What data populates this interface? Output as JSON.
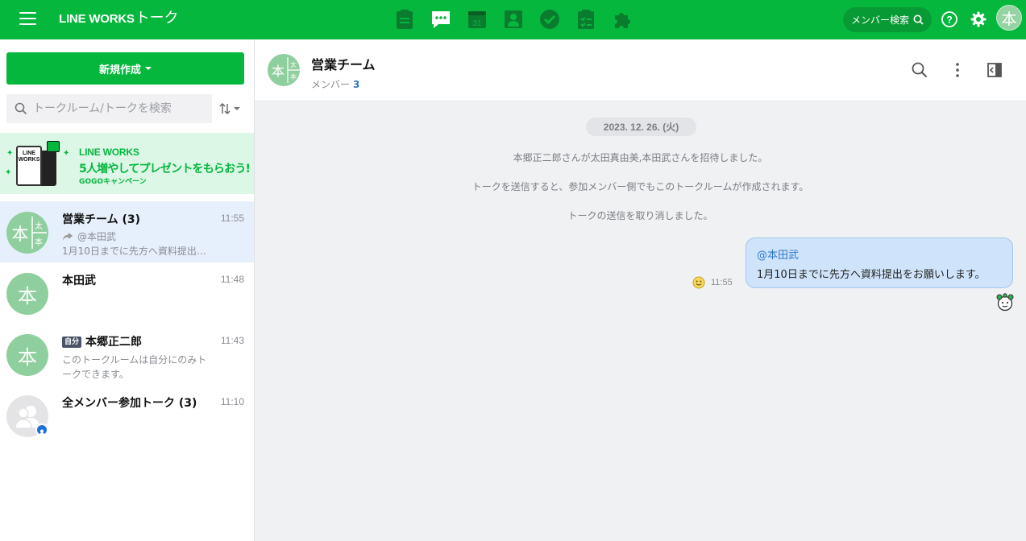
{
  "topbar": {
    "brand": "LINE WORKS",
    "brand_sub": "トーク",
    "member_search": "メンバー検索",
    "avatar_char": "本",
    "apps": [
      "board-icon",
      "talk-icon",
      "calendar-icon",
      "contacts-icon",
      "task-icon",
      "survey-icon",
      "extension-icon"
    ]
  },
  "sidebar": {
    "new_button": "新規作成",
    "search_placeholder": "トークルーム/トークを検索",
    "banner": {
      "line1": "LINE WORKS",
      "line2": "5人増やしてプレゼントをもらおう!",
      "line3": "GOGOキャンペーン",
      "phone_text": "LINE WORKS"
    },
    "rooms": [
      {
        "name": "営業チーム (3)",
        "time": "11:55",
        "line1": "@本田武",
        "line2": "1月10日までに先方へ資料提出…",
        "avatar": "本",
        "avatar_small_1": "太",
        "avatar_small_2": "本"
      },
      {
        "name": "本田武",
        "time": "11:48",
        "avatar": "本"
      },
      {
        "name": "本郷正二郎",
        "badge": "自分",
        "time": "11:43",
        "preview": "このトークルームは自分にのみトークできます。",
        "avatar": "本"
      },
      {
        "name": "全メンバー参加トーク (3)",
        "time": "11:10"
      }
    ]
  },
  "chat": {
    "title": "営業チーム",
    "members_label": "メンバー",
    "members_count": "3",
    "avatar": "本",
    "avatar_small_1": "太",
    "avatar_small_2": "本",
    "date": "2023. 12. 26. (火)",
    "system_messages": [
      "本郷正二郎さんが太田真由美,本田武さんを招待しました。",
      "トークを送信すると、参加メンバー側でもこのトークルームが作成されます。",
      "トークの送信を取り消しました。"
    ],
    "message": {
      "mention": "@本田武",
      "text": "1月10日までに先方へ資料提出をお願いします。",
      "time": "11:55"
    }
  },
  "colors": {
    "brand": "#06b73e",
    "bubble": "#cfe4fb",
    "mention": "#2d79c7"
  }
}
